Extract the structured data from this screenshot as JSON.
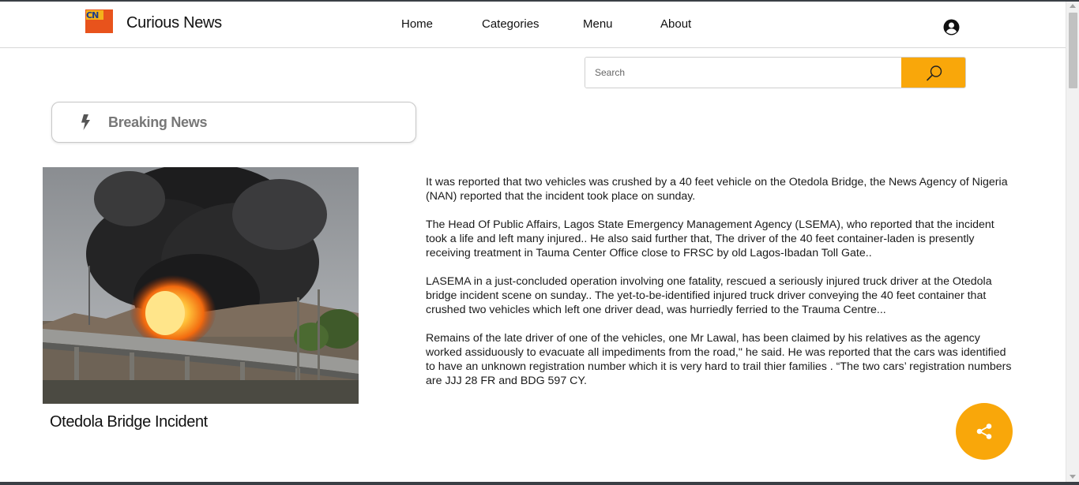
{
  "header": {
    "logo_text": "CN",
    "brand": "Curious News",
    "nav": [
      {
        "label": "Home"
      },
      {
        "label": "Categories"
      },
      {
        "label": "Menu"
      },
      {
        "label": "About"
      }
    ],
    "user_icon": "user-circle-icon"
  },
  "search": {
    "placeholder": "Search",
    "value": "",
    "button_icon": "search-icon"
  },
  "breaking": {
    "icon": "bolt-icon",
    "label": "Breaking News"
  },
  "story": {
    "image_icon": "fire-smoke-photo",
    "caption": "Otedola Bridge Incident",
    "paragraphs": [
      "It was reported that two vehicles was crushed by a 40 feet vehicle on the Otedola Bridge, the News Agency of Nigeria (NAN) reported that the incident took place on sunday.",
      "The Head Of Public Affairs, Lagos State Emergency Management Agency (LSEMA), who reported that the incident took a life and left many injured.. He also said further that, The driver of the 40 feet container-laden is presently receiving treatment in Tauma Center Office close to FRSC by old Lagos-Ibadan Toll Gate..",
      "LASEMA in a just-concluded operation involving one fatality, rescued a seriously injured truck driver at the Otedola bridge incident scene on sunday.. The yet-to-be-identified injured truck driver conveying the 40 feet container that crushed two vehicles which left one driver dead, was hurriedly ferried to the Trauma Centre...",
      "Remains of the late driver of one of the vehicles, one Mr Lawal, has been claimed by his relatives as the agency worked assiduously to evacuate all impediments from the road,\" he said. He was reported that the cars was identified to have an unknown registration number which it is very hard to trail thier families . “The two cars’ registration numbers are JJJ 28 FR and BDG 597 CY."
    ]
  },
  "share": {
    "icon": "share-icon"
  },
  "colors": {
    "accent": "#f9a70a",
    "logo_orange": "#e8531c",
    "logo_yellow": "#f4b21b",
    "muted_label": "#777777"
  }
}
